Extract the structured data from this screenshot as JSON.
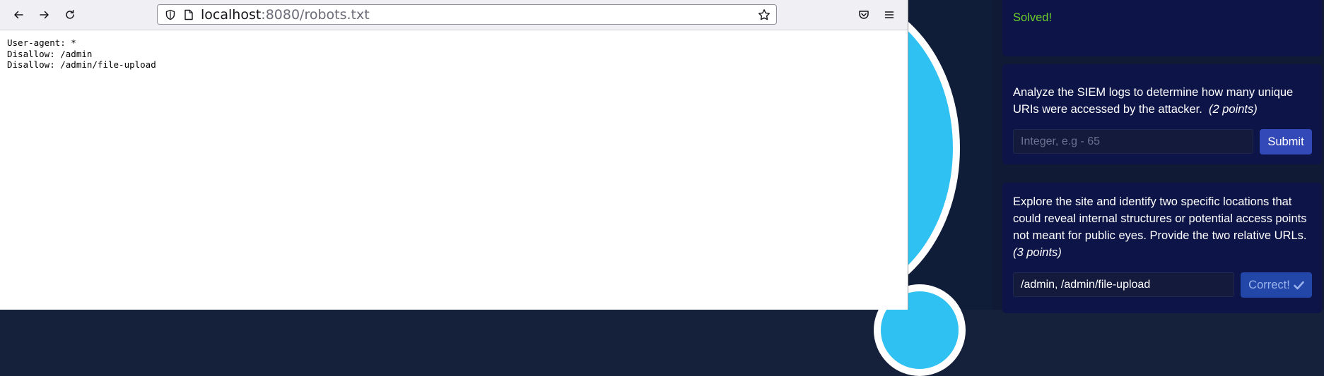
{
  "browser": {
    "url_host": "localhost",
    "url_rest": ":8080/robots.txt",
    "content": "User-agent: *\nDisallow: /admin\nDisallow: /admin/file-upload"
  },
  "panel": {
    "solved_text": "Solved!",
    "q1": {
      "question": "Analyze the SIEM logs to determine how many unique URIs were accessed by the attacker.",
      "points": "(2 points)",
      "placeholder": "Integer, e.g - 65",
      "button_label": "Submit"
    },
    "q2": {
      "question": "Explore the site and identify two specific locations that could reveal internal structures or potential access points not meant for public eyes. Provide the two relative URLs.",
      "points": "(3 points)",
      "answer": "/admin, /admin/file-upload",
      "button_label": "Correct!"
    }
  },
  "colors": {
    "solved": "#6fcf2a",
    "card_bg": "#0d1448",
    "submit_bg": "#3449b8",
    "correct_bg": "#2347a9",
    "ring": "#2ec1f2"
  },
  "icons": [
    "back-icon",
    "forward-icon",
    "reload-icon",
    "shield-icon",
    "page-icon",
    "bookmark-star-icon",
    "pocket-icon",
    "hamburger-menu-icon",
    "checkmark-icon"
  ]
}
